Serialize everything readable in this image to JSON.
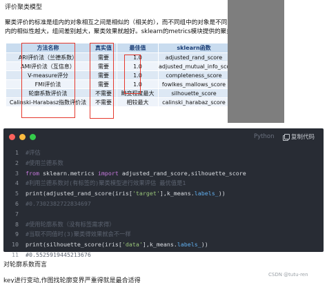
{
  "slide": {
    "title": "评价聚类模型",
    "paragraph": "聚类评价的标准是组内的对象相互之间是相似的（相关的），而不同组中的对象是不同的（不相关的）。即组内的相似性越大，组间差别越大，聚类效果就越好。sklearn的metrics模块提供的聚类模型评价指标。",
    "table": {
      "headers": [
        "方法名称",
        "真实值",
        "最佳值",
        "sklearn函数"
      ],
      "rows": [
        [
          "ARI评价法（兰德系数）",
          "需要",
          "1.0",
          "adjusted_rand_score"
        ],
        [
          "AMI评价法（互信息）",
          "需要",
          "1.0",
          "adjusted_mutual_info_score"
        ],
        [
          "V-measure评分",
          "需要",
          "1.0",
          "completeness_score"
        ],
        [
          "FMI评价法",
          "需要",
          "1.0",
          "fowlkes_mallows_score"
        ],
        [
          "轮廓系数评价法",
          "不需要",
          "畸变程度最大",
          "silhouette_score"
        ],
        [
          "Calinski-Harabasz指数评价法",
          "不需要",
          "相较最大",
          "calinski_harabaz_score"
        ]
      ]
    },
    "colors": {
      "header_bg": "#c9dcef",
      "row_odd": "#dde8f4",
      "row_even": "#eef3fa",
      "highlight_box": "#e5372b",
      "side_panel": "#7e7e7e"
    }
  },
  "code": {
    "language": "Python",
    "copy_label": "复制代码",
    "icons": [
      "copy-icon"
    ],
    "lines": [
      {
        "n": "1",
        "segments": [
          {
            "t": "#评估",
            "c": "comment"
          }
        ]
      },
      {
        "n": "2",
        "segments": [
          {
            "t": "#使用兰德系数",
            "c": "comment"
          }
        ]
      },
      {
        "n": "3",
        "segments": [
          {
            "t": "from",
            "c": "kw"
          },
          {
            "t": " sklearn.metrics ",
            "c": "plain"
          },
          {
            "t": "import",
            "c": "kw"
          },
          {
            "t": " adjusted_rand_score,silhouette_score",
            "c": "plain"
          }
        ]
      },
      {
        "n": "4",
        "segments": [
          {
            "t": "#利用兰德系数对(有标签的)聚类模型进行效果评估 最优值是1",
            "c": "comment"
          }
        ]
      },
      {
        "n": "5",
        "segments": [
          {
            "t": "print(adjusted_rand_score(iris[",
            "c": "plain"
          },
          {
            "t": "'target'",
            "c": "str"
          },
          {
            "t": "],k_means.",
            "c": "plain"
          },
          {
            "t": "labels_",
            "c": "attr"
          },
          {
            "t": "))",
            "c": "plain"
          }
        ]
      },
      {
        "n": "6",
        "segments": [
          {
            "t": "#0.7302382722834697",
            "c": "comment"
          }
        ]
      },
      {
        "n": "7",
        "segments": [
          {
            "t": "",
            "c": "plain"
          }
        ]
      },
      {
        "n": "8",
        "segments": [
          {
            "t": "#使用轮廓系数（没有标签需求得）",
            "c": "comment"
          }
        ]
      },
      {
        "n": "9",
        "segments": [
          {
            "t": "#当取不同值时(3)聚类得效果就会不一样",
            "c": "comment"
          }
        ]
      },
      {
        "n": "10",
        "segments": [
          {
            "t": "print(silhouette_score(iris[",
            "c": "plain"
          },
          {
            "t": "'data'",
            "c": "str"
          },
          {
            "t": "],k_means.",
            "c": "plain"
          },
          {
            "t": "labels_",
            "c": "attr"
          },
          {
            "t": "))",
            "c": "plain"
          }
        ]
      },
      {
        "n": "11",
        "segments": [
          {
            "t": "#0.5525919445213676",
            "c": "comment"
          }
        ]
      }
    ],
    "dot_colors": [
      "#fc625d",
      "#fdbc40",
      "#35cd4b"
    ]
  },
  "after_text": "对轮廓系数而言",
  "after_text_2": "key进行变动,作图找轮廓变界严重得就是最合适得",
  "watermark": "CSDN @tutu-ren"
}
